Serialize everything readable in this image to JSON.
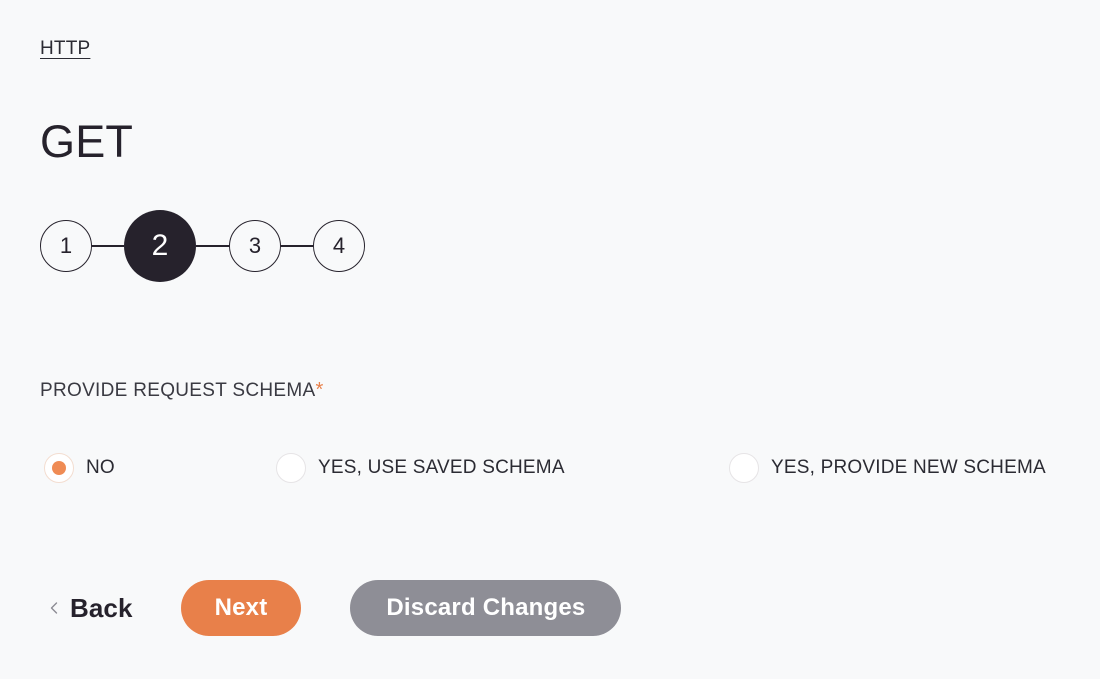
{
  "breadcrumb": {
    "label": "HTTP"
  },
  "header": {
    "title": "GET"
  },
  "stepper": {
    "current_step": 2,
    "steps": [
      {
        "number": "1",
        "state": "inactive"
      },
      {
        "number": "2",
        "state": "active"
      },
      {
        "number": "3",
        "state": "inactive"
      },
      {
        "number": "4",
        "state": "inactive"
      }
    ]
  },
  "form": {
    "field": {
      "label": "PROVIDE REQUEST SCHEMA",
      "required_marker": "*",
      "required": true,
      "selected_value": "NO",
      "options": [
        {
          "label": "NO",
          "checked": true
        },
        {
          "label": "YES, USE SAVED SCHEMA",
          "checked": false
        },
        {
          "label": "YES, PROVIDE NEW SCHEMA",
          "checked": false
        }
      ]
    }
  },
  "actions": {
    "back_label": "Back",
    "back_icon": "chevron-left-icon",
    "next_label": "Next",
    "discard_label": "Discard Changes"
  },
  "colors": {
    "background": "#f8f9fa",
    "accent_orange": "#e8804a",
    "radio_dot": "#ef8b54",
    "dark": "#26222c",
    "secondary_gray": "#8e8e96",
    "text": "#2b2b33"
  }
}
